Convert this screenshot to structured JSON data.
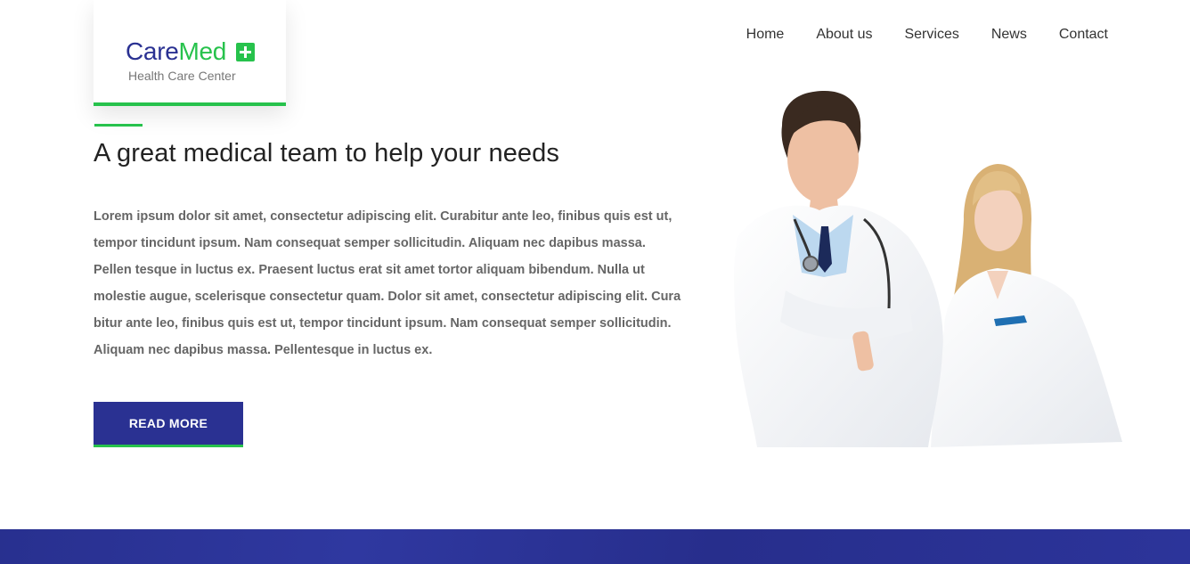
{
  "brand": {
    "name_part1": "Care",
    "name_part2": "Med",
    "tagline": "Health Care Center",
    "primary_color": "#2a3192",
    "accent_color": "#27c24c",
    "logo_icon": "plus-icon"
  },
  "nav": {
    "items": [
      {
        "label": "Home"
      },
      {
        "label": "About us"
      },
      {
        "label": "Services"
      },
      {
        "label": "News"
      },
      {
        "label": "Contact"
      }
    ]
  },
  "hero": {
    "heading": "A great medical team to help your needs",
    "body": "Lorem ipsum dolor sit amet, consectetur adipiscing elit. Curabitur ante leo, finibus quis est ut, tempor tincidunt ipsum. Nam consequat semper sollicitudin. Aliquam nec dapibus massa. Pellen tesque in luctus ex. Praesent luctus erat sit amet tortor aliquam bibendum. Nulla ut molestie augue, scelerisque consectetur quam. Dolor sit amet, consectetur adipiscing elit. Cura bitur ante leo, finibus quis est ut, tempor tincidunt ipsum. Nam consequat semper sollicitudin. Aliquam nec dapibus massa. Pellentesque in luctus ex.",
    "cta_label": "READ MORE",
    "image": "doctors-photo"
  }
}
